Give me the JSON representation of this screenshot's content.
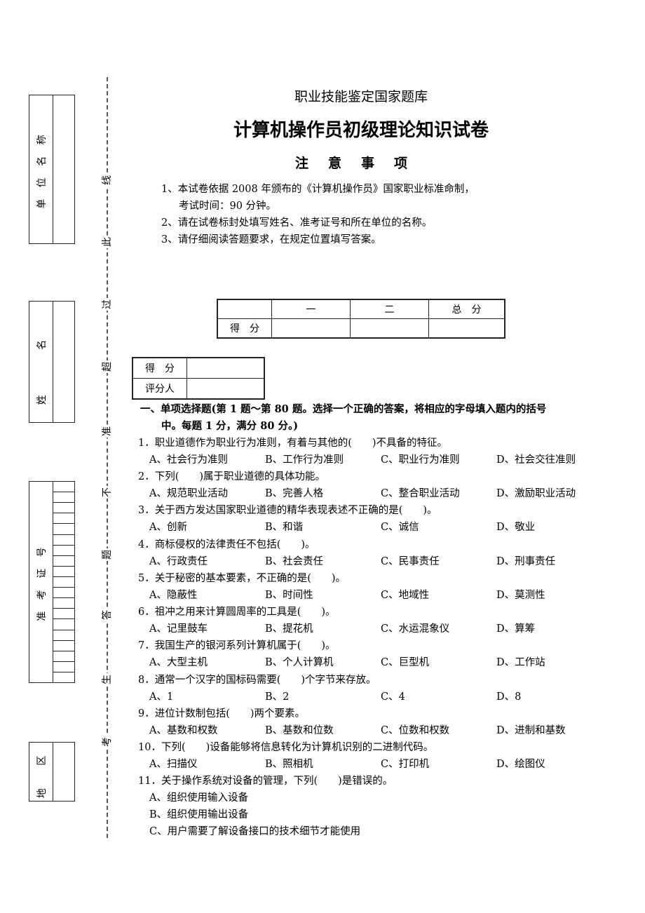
{
  "binding": {
    "unit_name_label": "单 位 名 称",
    "name_label": "姓 名",
    "exam_id_label": "准 考 证 号",
    "region_label": "地 区",
    "cut_line_chars": [
      "线",
      "此",
      "过",
      "超",
      "准",
      "不",
      "题",
      "答",
      "生",
      "考"
    ]
  },
  "header": {
    "subtitle": "职业技能鉴定国家题库",
    "title": "计算机操作员初级理论知识试卷",
    "notice_heading": "注意事项",
    "notices": [
      "1、本试卷依据 2008 年颁布的《计算机操作员》国家职业标准命制，",
      "考试时间：90 分钟。",
      "2、请在试卷标封处填写姓名、准考证号和所在单位的名称。",
      "3、请仔细阅读答题要求，在规定位置填写答案。"
    ]
  },
  "score_table": {
    "headers": [
      "",
      "一",
      "二",
      "总　分"
    ],
    "row_label": "得　分"
  },
  "grader_table": {
    "score_label": "得　分",
    "grader_label": "评分人"
  },
  "section": {
    "line1": "一、单项选择题(第 1 题～第 80 题。选择一个正确的答案，将相应的字母填入题内的括号",
    "line2": "中。每题 1 分，满分 80 分。)"
  },
  "questions": [
    {
      "stem": "1．职业道德作为职业行为准则，有着与其他的(　　)不具备的特征。",
      "options": [
        "A、社会行为准则",
        "B、工作行为准则",
        "C、职业行为准则",
        "D、社会交往准则"
      ]
    },
    {
      "stem": "2．下列(　　)属于职业道德的具体功能。",
      "options": [
        "A、规范职业活动",
        "B、完善人格",
        "C、整合职业活动",
        "D、激励职业活动"
      ]
    },
    {
      "stem": "3．关于西方发达国家职业道德的精华表现表述不正确的是(　　)。",
      "options": [
        "A、创新",
        "B、和谐",
        "C、诚信",
        "D、敬业"
      ]
    },
    {
      "stem": "4．商标侵权的法律责任不包括(　　)。",
      "options": [
        "A、行政责任",
        "B、社会责任",
        "C、民事责任",
        "D、刑事责任"
      ]
    },
    {
      "stem": "5．关于秘密的基本要素，不正确的是(　　)。",
      "options": [
        "A、隐蔽性",
        "B、时间性",
        "C、地域性",
        "D、莫测性"
      ]
    },
    {
      "stem": "6．祖冲之用来计算圆周率的工具是(　　)。",
      "options": [
        "A、记里鼓车",
        "B、提花机",
        "C、水运混象仪",
        "D、算筹"
      ]
    },
    {
      "stem": "7．我国生产的银河系列计算机属于(　　)。",
      "options": [
        "A、大型主机",
        "B、个人计算机",
        "C、巨型机",
        "D、工作站"
      ]
    },
    {
      "stem": "8．通常一个汉字的国标码需要(　　)个字节来存放。",
      "options": [
        "A、1",
        "B、2",
        "C、4",
        "D、8"
      ]
    },
    {
      "stem": "9．进位计数制包括(　　)两个要素。",
      "options": [
        "A、基数和权数",
        "B、基数和位数",
        "C、位数和权数",
        "D、进制和基数"
      ]
    },
    {
      "stem": "10．下列(　　)设备能够将信息转化为计算机识别的二进制代码。",
      "options": [
        "A、扫描仪",
        "B、照相机",
        "C、打印机",
        "D、绘图仪"
      ]
    },
    {
      "stem": "11．关于操作系统对设备的管理，下列(　　)是错误的。",
      "options_stacked": [
        "A、组织使用输入设备",
        "B、组织使用输出设备",
        "C、用户需要了解设备接口的技术细节才能使用"
      ]
    }
  ]
}
